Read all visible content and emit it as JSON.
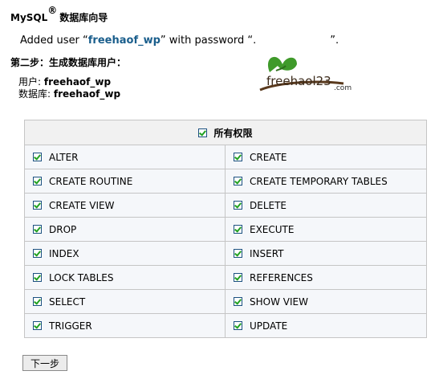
{
  "header": {
    "title_main": "MySQL",
    "title_reg": "®",
    "title_tail": "数据库向导"
  },
  "message": {
    "prefix": "Added user “",
    "username": "freehaof_wp",
    "middle": "” with password “.",
    "suffix": "”."
  },
  "step": {
    "title": "第二步：生成数据库用户："
  },
  "info": {
    "user_label": "用户:",
    "user_value": "freehaof_wp",
    "db_label": "数据库:",
    "db_value": "freehaof_wp"
  },
  "logo": {
    "text": "freehaol23",
    "suffix": ".com"
  },
  "permissions": {
    "header_label": "所有权限",
    "rows": [
      [
        "ALTER",
        "CREATE"
      ],
      [
        "CREATE ROUTINE",
        "CREATE TEMPORARY TABLES"
      ],
      [
        "CREATE VIEW",
        "DELETE"
      ],
      [
        "DROP",
        "EXECUTE"
      ],
      [
        "INDEX",
        "INSERT"
      ],
      [
        "LOCK TABLES",
        "REFERENCES"
      ],
      [
        "SELECT",
        "SHOW VIEW"
      ],
      [
        "TRIGGER",
        "UPDATE"
      ]
    ]
  },
  "actions": {
    "next_label": "下一步"
  },
  "colors": {
    "user_link": "#1a5e8c",
    "check_green": "#21a121",
    "border": "#c5c5c5"
  }
}
